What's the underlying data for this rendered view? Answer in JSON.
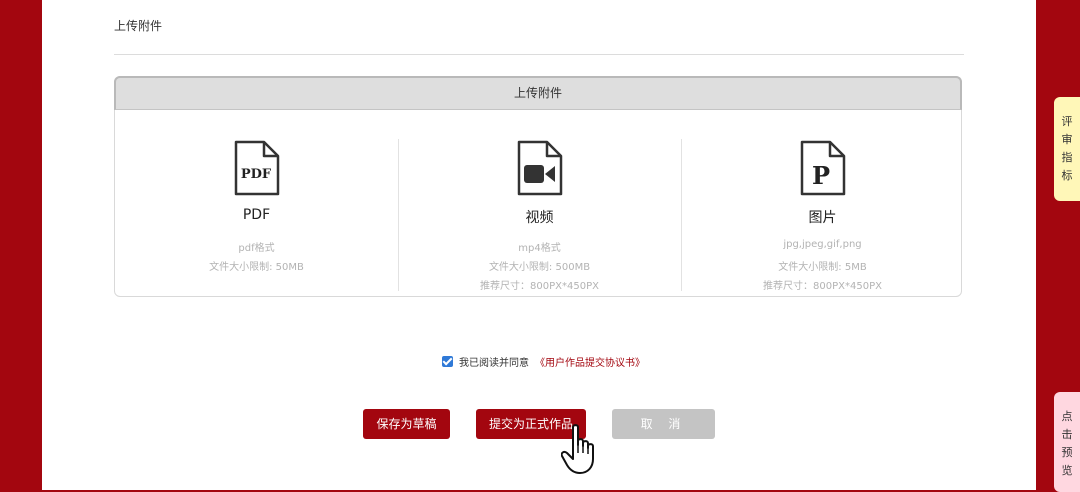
{
  "section": {
    "title": "上传附件"
  },
  "upload": {
    "header": "上传附件",
    "columns": [
      {
        "icon": "pdf-file-icon",
        "icon_text": "PDF",
        "title": "PDF",
        "lines": [
          "pdf格式",
          "文件大小限制: 50MB"
        ]
      },
      {
        "icon": "video-file-icon",
        "title": "视频",
        "lines": [
          "mp4格式",
          "文件大小限制: 500MB",
          "推荐尺寸：800PX*450PX"
        ]
      },
      {
        "icon": "image-file-icon",
        "icon_text": "P",
        "title": "图片",
        "lines": [
          "jpg,jpeg,gif,png",
          "文件大小限制: 5MB",
          "推荐尺寸：800PX*450PX"
        ]
      }
    ]
  },
  "agreement": {
    "checked": true,
    "text": "我已阅读并同意",
    "link": "《用户作品提交协议书》"
  },
  "buttons": {
    "draft": "保存为草稿",
    "submit": "提交为正式作品",
    "cancel": "取 消"
  },
  "side_tabs": {
    "review": [
      "评",
      "审",
      "指",
      "标"
    ],
    "preview": [
      "点",
      "击",
      "预",
      "览"
    ]
  },
  "colors": {
    "brand": "#a3060f",
    "checkbox": "#2f79d7",
    "review_tab": "#fff7b8",
    "preview_tab": "#ffd7e0"
  }
}
